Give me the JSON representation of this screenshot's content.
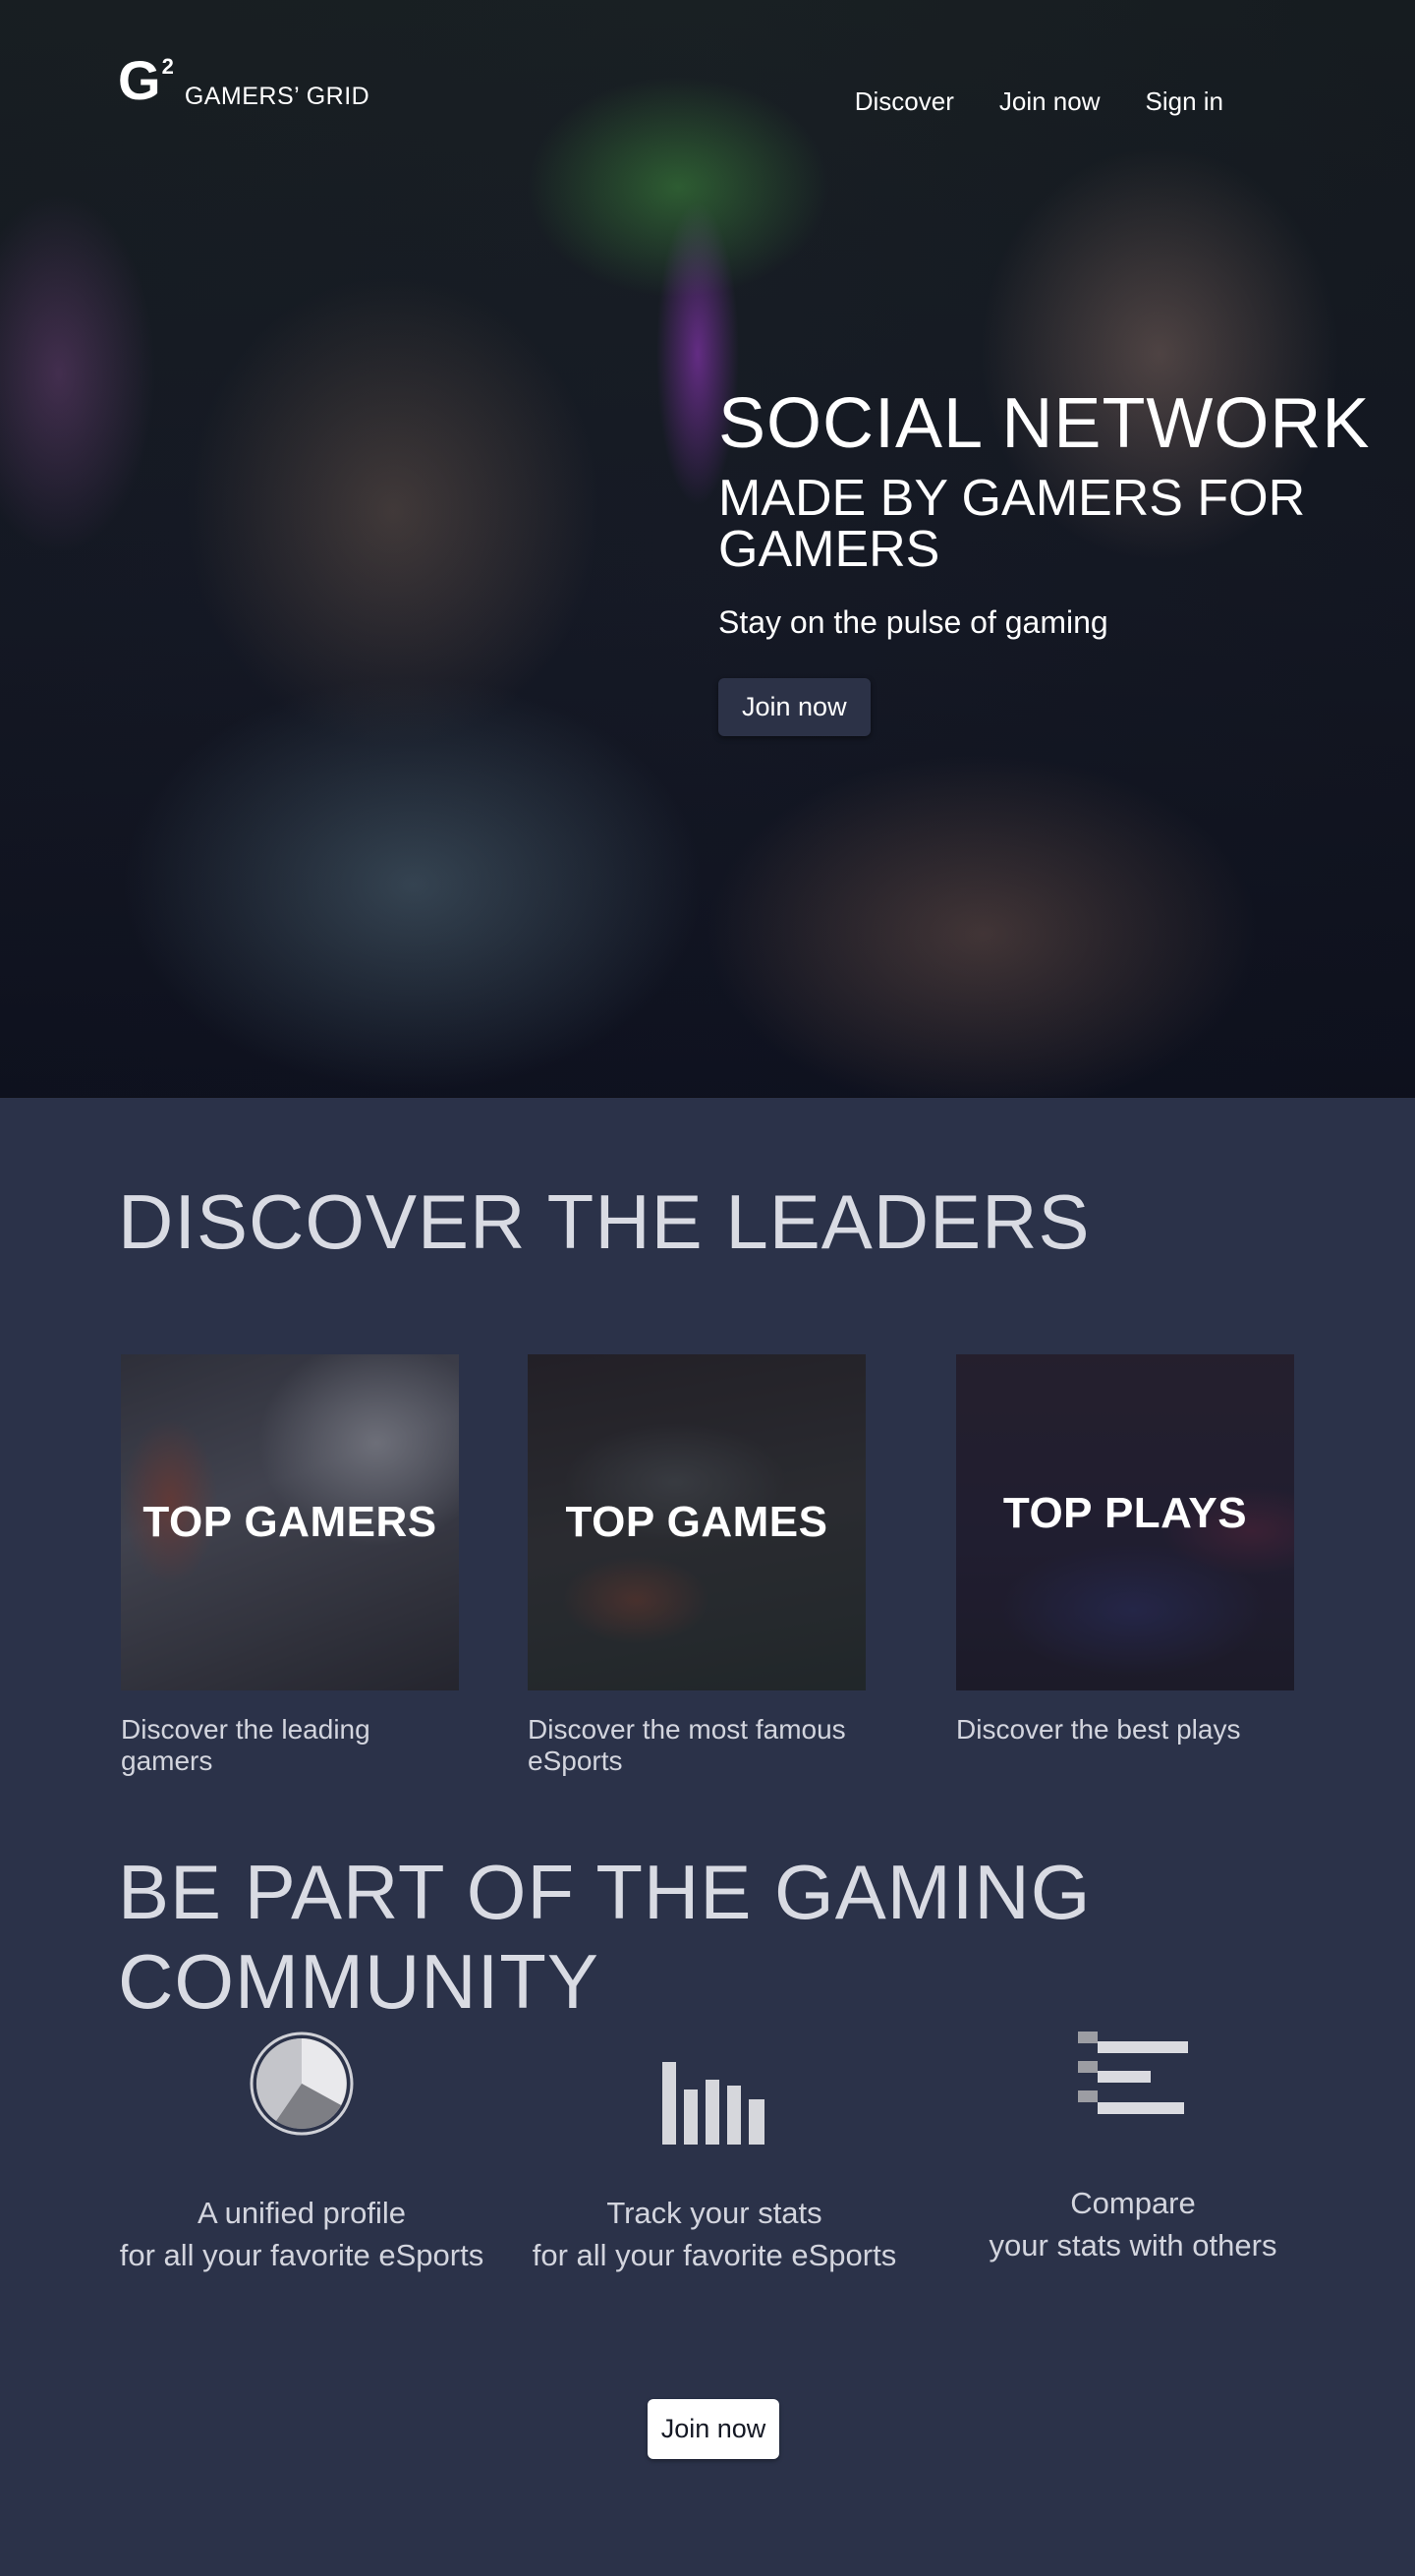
{
  "brand": {
    "mark": "G",
    "mark_sup": "2",
    "name": "GAMERS’ GRID"
  },
  "nav": {
    "items": [
      "Discover",
      "Join now",
      "Sign in"
    ]
  },
  "hero": {
    "title": "SOCIAL NETWORK",
    "subtitle": "MADE BY GAMERS FOR GAMERS",
    "tagline": "Stay on the pulse of gaming",
    "button": "Join now"
  },
  "leaders": {
    "title": "DISCOVER THE LEADERS",
    "cards": [
      {
        "label": "TOP GAMERS",
        "desc": "Discover the leading gamers"
      },
      {
        "label": "TOP GAMES",
        "desc": "Discover the most famous eSports"
      },
      {
        "label": "TOP PLAYS",
        "desc": "Discover the best plays"
      }
    ]
  },
  "community": {
    "title": "BE PART OF THE GAMING COMMUNITY",
    "features": [
      {
        "icon": "pie-chart-icon",
        "line1": "A unified  profile",
        "line2": "for all your favorite eSports"
      },
      {
        "icon": "bar-chart-icon",
        "line1": "Track your stats",
        "line2": "for all your favorite eSports"
      },
      {
        "icon": "horizontal-bars-icon",
        "line1": "Compare",
        "line2": "your stats with others"
      }
    ],
    "button": "Join now"
  }
}
